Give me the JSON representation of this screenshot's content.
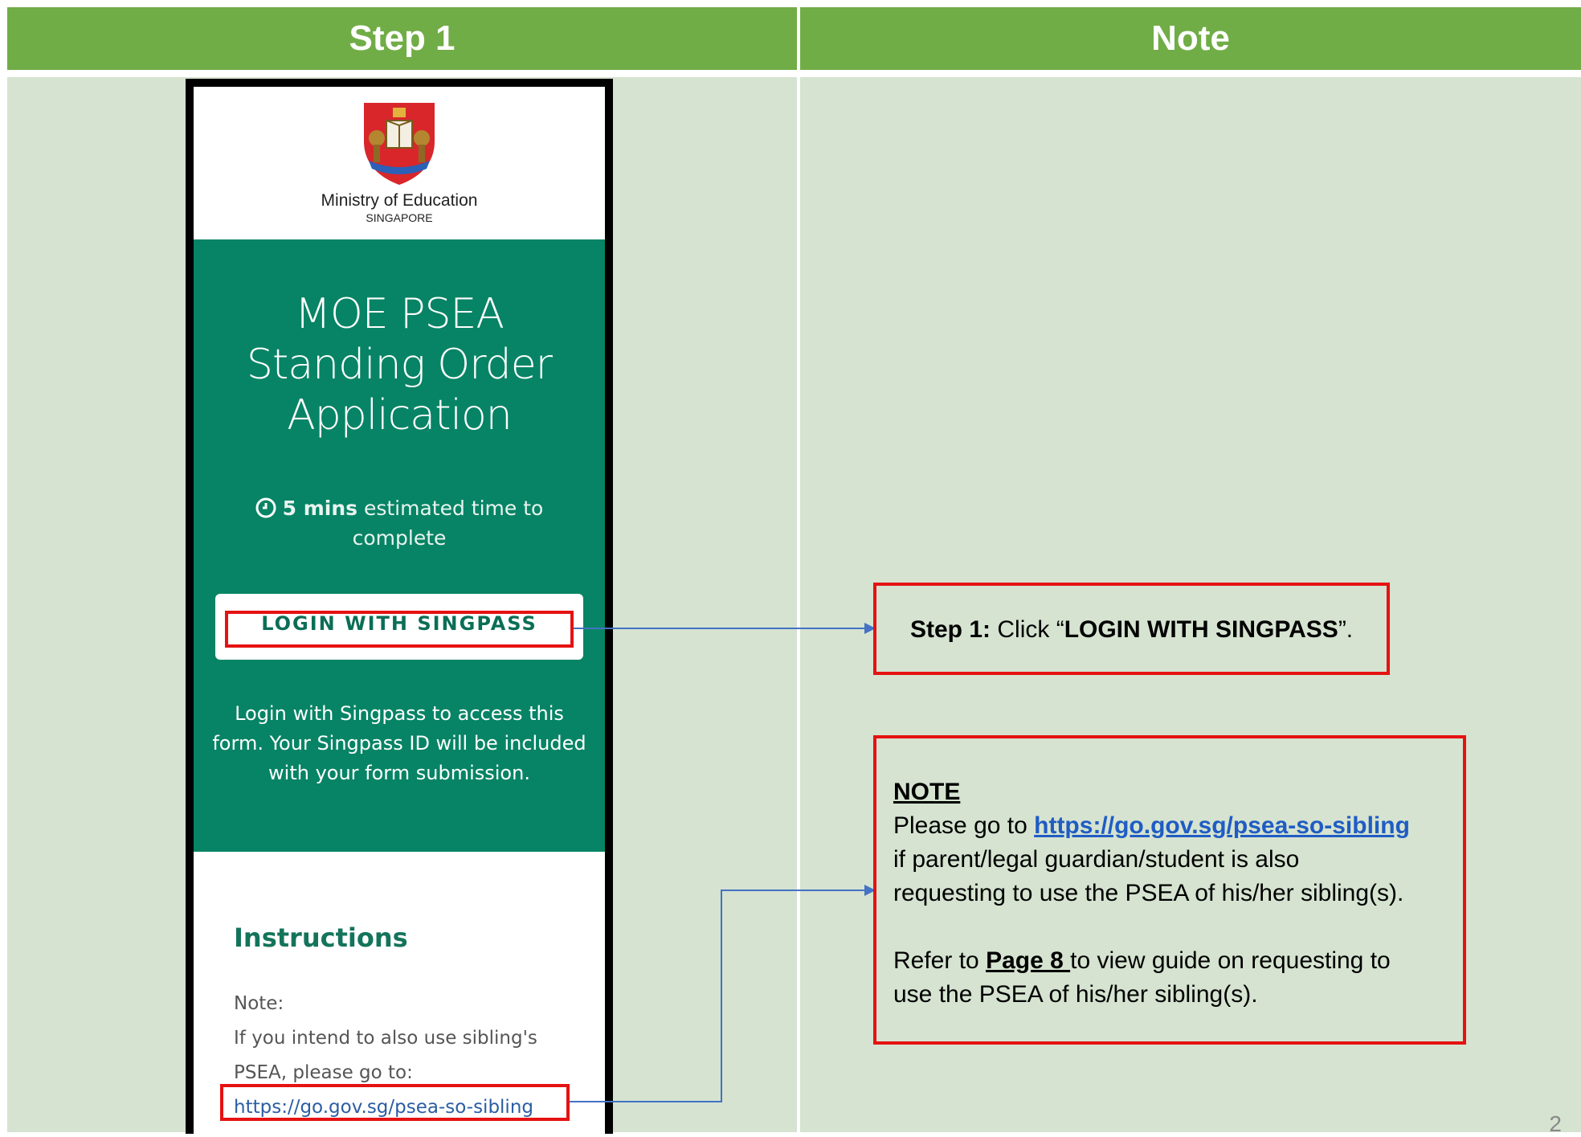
{
  "headers": {
    "left": "Step 1",
    "right": "Note"
  },
  "phone": {
    "org_name": "Ministry of Education",
    "org_country": "SINGAPORE",
    "title_lines": [
      "MOE PSEA",
      "Standing Order",
      "Application"
    ],
    "estimate_bold": "5 mins",
    "estimate_rest": "estimated time to complete",
    "login_button": "LOGIN WITH SINGPASS",
    "login_desc": "Login with Singpass to access this form. Your Singpass ID will be included with your form submission.",
    "instructions_heading": "Instructions",
    "note_label": "Note:",
    "note_line1": "If you intend to also use sibling's",
    "note_line2": "PSEA, please go to:",
    "note_link": "https://go.gov.sg/psea-so-sibling"
  },
  "callout1": {
    "prefix_bold": "Step 1:",
    "text_before": " Click “",
    "button_bold": "LOGIN WITH SINGPASS",
    "text_after": "”."
  },
  "callout2": {
    "heading": "NOTE",
    "line1_prefix": "Please go to ",
    "link": "https://go.gov.sg/psea-so-sibling",
    "line2": "if parent/legal guardian/student is also",
    "line3": "requesting to use the PSEA of his/her sibling(s).",
    "line4_prefix": "Refer to ",
    "page_ref": "Page 8 ",
    "line4_suffix": "to view guide on requesting to",
    "line5": "use the PSEA of his/her sibling(s)."
  },
  "page_number": "2",
  "colors": {
    "header_green": "#71ad47",
    "panel_green": "#d5e3d0",
    "form_green": "#078465",
    "highlight_red": "#e51212",
    "arrow_blue": "#4472c4"
  }
}
